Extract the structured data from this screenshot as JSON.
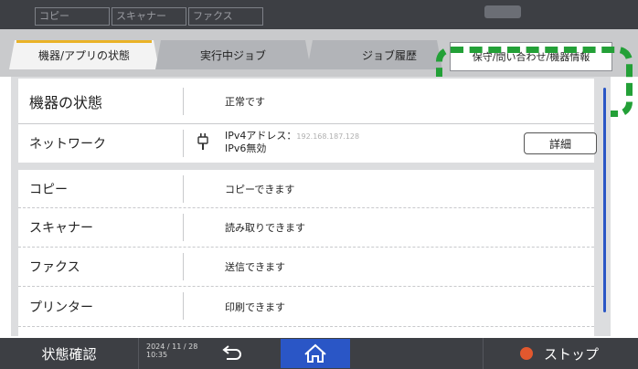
{
  "top_tabs": [
    "コピー",
    "スキャナー",
    "ファクス"
  ],
  "tabs": {
    "status": "機器/アプリの状態",
    "jobs": "実行中ジョブ",
    "history": "ジョブ履歴",
    "maintenance": "保守/問い合わせ/機器情報"
  },
  "machine": {
    "label": "機器の状態",
    "value": "正常です"
  },
  "network": {
    "label": "ネットワーク",
    "ipv4_label": "IPv4アドレス：",
    "ipv4_value": "192.168.187.128",
    "ipv6": "IPv6無効",
    "detail_button": "詳細"
  },
  "functions": [
    {
      "label": "コピー",
      "value": "コピーできます"
    },
    {
      "label": "スキャナー",
      "value": "読み取りできます"
    },
    {
      "label": "ファクス",
      "value": "送信できます"
    },
    {
      "label": "プリンター",
      "value": "印刷できます"
    }
  ],
  "bottom": {
    "status_label": "状態確認",
    "date": "2024 / 11 / 28",
    "time": "10:35",
    "stop_label": "ストップ"
  },
  "colors": {
    "accent": "#e9b227",
    "highlight": "#23a037",
    "home": "#2a56c6",
    "stop": "#e2582e"
  }
}
